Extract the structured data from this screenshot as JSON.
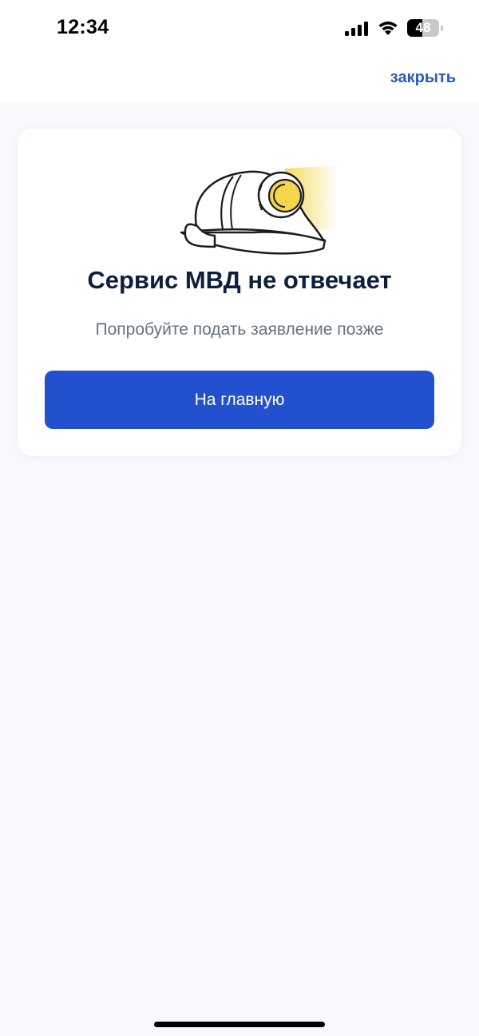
{
  "status_bar": {
    "time": "12:34",
    "battery_level": "48",
    "battery_fraction": 0.48
  },
  "nav": {
    "close_label": "закрыть"
  },
  "error_card": {
    "title": "Сервис МВД не отвечает",
    "subtitle": "Попробуйте подать заявление позже",
    "button_label": "На главную",
    "illustration_icon": "miner-helmet-icon"
  },
  "colors": {
    "accent": "#2350ce",
    "link": "#2c5bb8",
    "title": "#0d1f3c",
    "subtitle": "#66727f",
    "background": "#f7f9fd",
    "lamp_light": "#f5d64a"
  }
}
